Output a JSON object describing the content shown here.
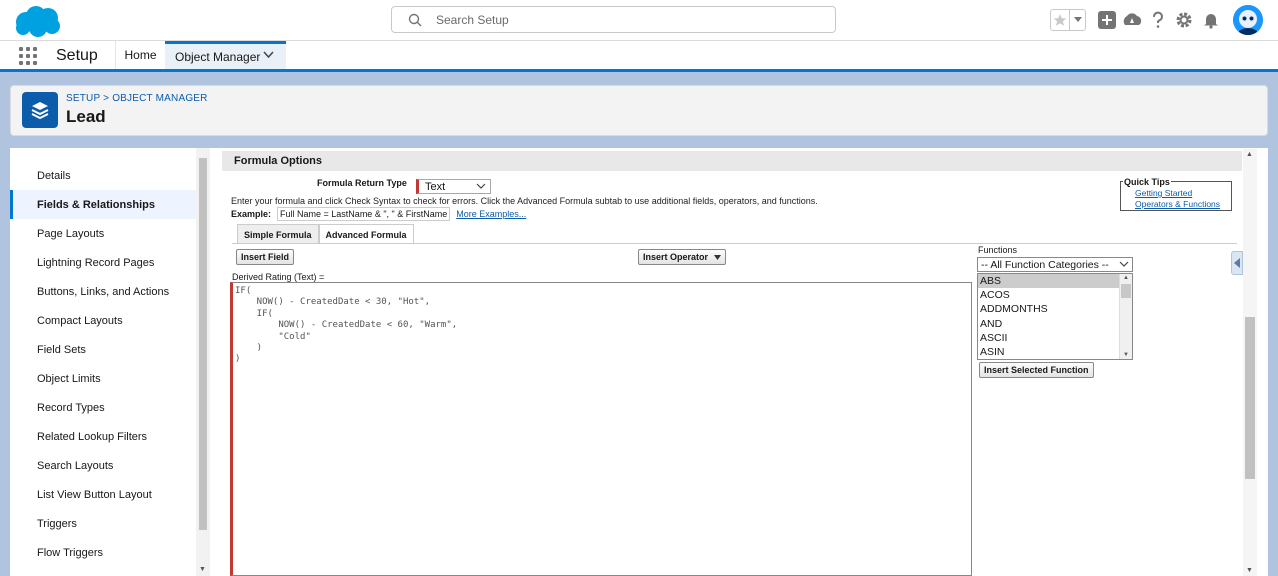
{
  "header": {
    "search_placeholder": "Search Setup"
  },
  "context_bar": {
    "app_name": "Setup",
    "tabs": [
      {
        "label": "Home"
      },
      {
        "label": "Object Manager"
      }
    ]
  },
  "page_header": {
    "breadcrumb_setup": "SETUP",
    "breadcrumb_separator": ">",
    "breadcrumb_object_manager": "OBJECT MANAGER",
    "title": "Lead"
  },
  "left_nav": {
    "items": [
      {
        "label": "Details"
      },
      {
        "label": "Fields & Relationships"
      },
      {
        "label": "Page Layouts"
      },
      {
        "label": "Lightning Record Pages"
      },
      {
        "label": "Buttons, Links, and Actions"
      },
      {
        "label": "Compact Layouts"
      },
      {
        "label": "Field Sets"
      },
      {
        "label": "Object Limits"
      },
      {
        "label": "Record Types"
      },
      {
        "label": "Related Lookup Filters"
      },
      {
        "label": "Search Layouts"
      },
      {
        "label": "List View Button Layout"
      },
      {
        "label": "Triggers"
      },
      {
        "label": "Flow Triggers"
      }
    ],
    "active_item": "Fields & Relationships"
  },
  "formula": {
    "section_title": "Formula Options",
    "return_type_label": "Formula Return Type",
    "return_type_value": "Text",
    "instructions": "Enter your formula and click Check Syntax to check for errors. Click the Advanced Formula subtab to use additional fields, operators, and functions.",
    "example_label": "Example:",
    "example_value": "Full Name = LastName & \", \" & FirstName",
    "more_examples": "More Examples...",
    "quick_tips_title": "Quick Tips",
    "quick_tips_links": [
      "Getting Started",
      "Operators & Functions"
    ],
    "tabs": [
      {
        "label": "Simple Formula"
      },
      {
        "label": "Advanced Formula"
      }
    ],
    "active_tab": "Advanced Formula",
    "insert_field_label": "Insert Field",
    "insert_operator_label": "Insert Operator",
    "derived_label": "Derived Rating (Text) =",
    "editor_text": "IF(\n    NOW() - CreatedDate < 30, \"Hot\",\n    IF(\n        NOW() - CreatedDate < 60, \"Warm\",\n        \"Cold\"\n    )\n)",
    "functions_label": "Functions",
    "function_category": "-- All Function Categories --",
    "function_list": [
      "ABS",
      "ACOS",
      "ADDMONTHS",
      "AND",
      "ASCII",
      "ASIN"
    ],
    "selected_function": "ABS",
    "insert_selected_function_label": "Insert Selected Function"
  },
  "colors": {
    "brand_blue": "#0176d3",
    "header_bg": "#b0c4df",
    "required_red": "#c23934"
  }
}
